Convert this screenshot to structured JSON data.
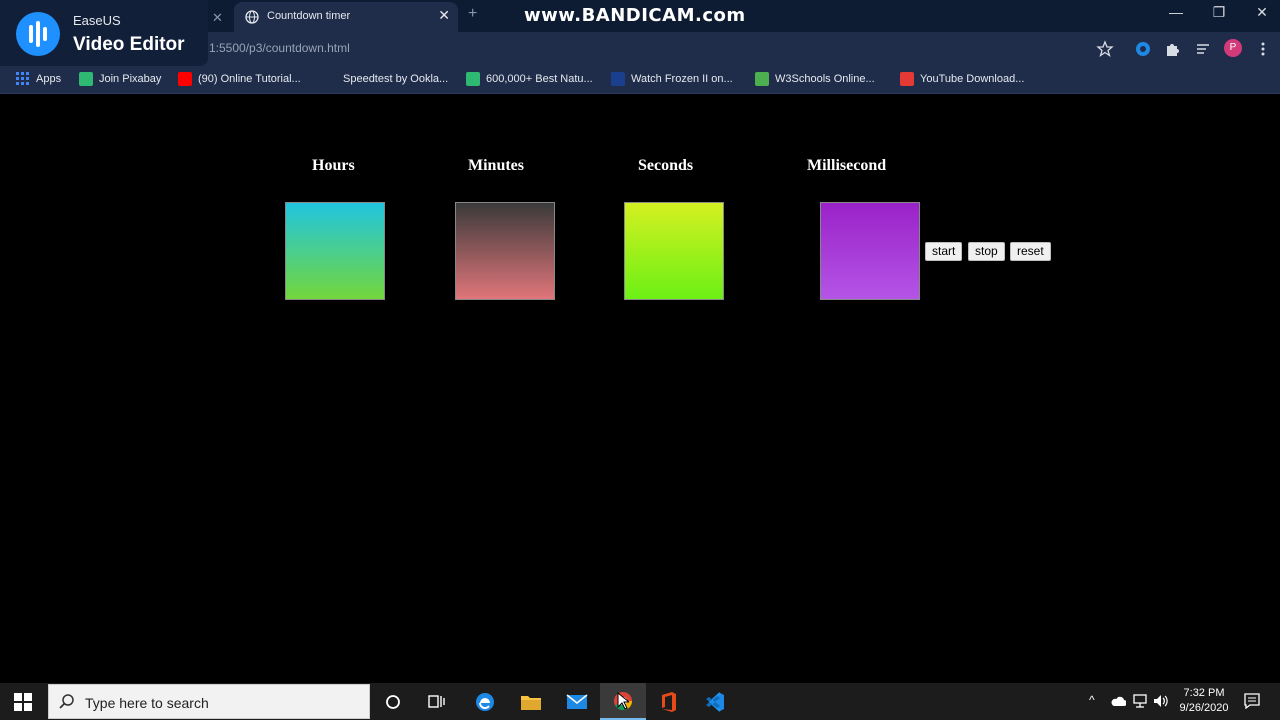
{
  "overlay": {
    "brand": "EaseUS",
    "product": "Video Editor",
    "watermark": "www.BANDICAM.com"
  },
  "browser": {
    "active_tab": {
      "title": "Countdown timer"
    },
    "address": "1:5500/p3/countdown.html",
    "avatar_letter": "P",
    "bookmarks": [
      {
        "label": "Apps",
        "color": "#4285f4"
      },
      {
        "label": "Join Pixabay",
        "color": "#2eb872"
      },
      {
        "label": "(90) Online Tutorial...",
        "color": "#ff0000"
      },
      {
        "label": "Speedtest by Ookla...",
        "color": "#1f2d4a"
      },
      {
        "label": "600,000+ Best Natu...",
        "color": "#2eb872"
      },
      {
        "label": "Watch Frozen II on...",
        "color": "#1a3f8f"
      },
      {
        "label": "W3Schools Online...",
        "color": "#4caf50"
      },
      {
        "label": "YouTube Download...",
        "color": "#e53935"
      }
    ]
  },
  "timer": {
    "units": [
      {
        "label": "Hours",
        "gradient": [
          "#21c5e0",
          "#73d63b"
        ]
      },
      {
        "label": "Minutes",
        "gradient": [
          "#3a3a3a",
          "#e0757a"
        ]
      },
      {
        "label": "Seconds",
        "gradient": [
          "#d4f021",
          "#6cf015"
        ]
      },
      {
        "label": "Millisecond",
        "gradient": [
          "#9a22c8",
          "#b455e6"
        ]
      }
    ],
    "controls": {
      "start": "start",
      "stop": "stop",
      "reset": "reset"
    }
  },
  "taskbar": {
    "search_placeholder": "Type here to search",
    "time": "7:32 PM",
    "date": "9/26/2020"
  }
}
